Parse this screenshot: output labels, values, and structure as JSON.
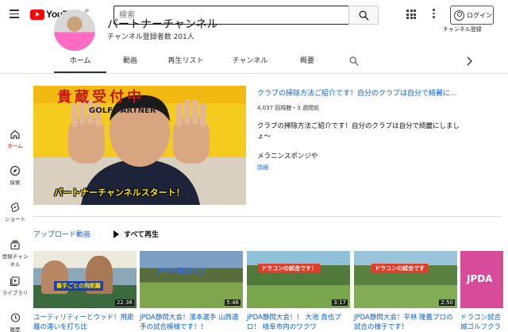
{
  "header": {
    "logo_text": "YouTube",
    "logo_region": "JP",
    "search_placeholder": "検索",
    "login_label": "ログイン",
    "channel_register_label": "チャンネル登録"
  },
  "channel": {
    "title": "パートナーチャンネル",
    "subscribers": "チャンネル登録者数 201人"
  },
  "tabs": [
    "ホーム",
    "動画",
    "再生リスト",
    "チャンネル",
    "概要"
  ],
  "active_tab": "ホーム",
  "nav": [
    {
      "label": "ホーム",
      "icon": "home-icon"
    },
    {
      "label": "探索",
      "icon": "compass-icon"
    },
    {
      "label": "ショート",
      "icon": "shorts-icon"
    },
    {
      "label": "登録チャンネル",
      "icon": "subscriptions-icon"
    },
    {
      "label": "ライブラリ",
      "icon": "library-icon"
    },
    {
      "label": "履歴",
      "icon": "history-icon"
    }
  ],
  "featured": {
    "title": "クラブの掃除方法ご紹介です！自分のクラブは自分で綺麗に...",
    "meta": "4,037 回視聴・3 週間前",
    "description": "クラブの掃除方法ご紹介です！自分のクラブは自分で綺麗にしましょ〜",
    "description2": "メラニンスポンジや",
    "more": "詳細",
    "thumb_caption": "パートナーチャンネルスタート！",
    "banner_text": "貴蔵受付中",
    "banner_sub": "GOLF PARTNER"
  },
  "shelf": {
    "title": "アップロード動画",
    "play_all": "すべて再生"
  },
  "videos": [
    {
      "title": "ユーティリティーとウッド！飛距離の違いを打ち比",
      "duration": "22:36",
      "overlay": "番手ごとの飛距離"
    },
    {
      "title": "JPDA静岡大会！濱本選手 山西選手の試合模様です！！",
      "duration": "5:46",
      "overlay": "JPDA静岡大会"
    },
    {
      "title": "JPDA静岡大会！！ 大池 貴也プロ！ 岐阜市内のワクワ",
      "duration": "3:17",
      "overlay": "ドラコンの試合です！"
    },
    {
      "title": "JPDA静岡大会！平林 隆義プロの試合の様子です！",
      "duration": "2:50",
      "overlay": "ドラコンの試合です"
    },
    {
      "title": "ドラコン試合城ゴルフクラ",
      "duration": "",
      "overlay": "JPDA"
    }
  ],
  "colors": {
    "accent_red": "#ff0000",
    "link_blue": "#065fd4"
  }
}
